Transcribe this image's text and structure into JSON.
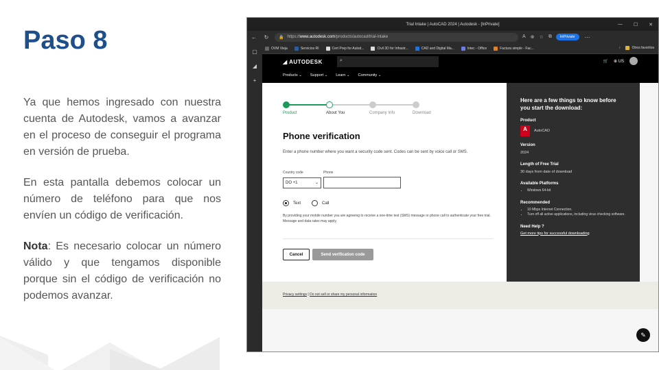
{
  "slide": {
    "title": "Paso 8",
    "p1": "Ya que hemos ingresado con nuestra cuenta de Autodesk, vamos a avanzar en el proceso de conseguir el programa en versión de prueba.",
    "p2": "En esta pantalla debemos colocar un número de teléfono para que nos envíen un código de verificación.",
    "p3_bold": "Nota",
    "p3_rest": ": Es necesario colocar un número válido y que tengamos disponible porque sin el código de verificación no podemos avanzar."
  },
  "browser": {
    "window_title": "Trial Intake | AutoCAD 2024 | Autodesk - [InPrivate]",
    "url_prefix": "https://",
    "url_host": "www.autodesk.com",
    "url_path": "/products/autocad/trial-intake",
    "inprivate_label": "InPrivate",
    "bookmarks": [
      {
        "label": "OVM Vieja",
        "color": "#666666"
      },
      {
        "label": "Servicios RI",
        "color": "#2a5ea8"
      },
      {
        "label": "Cert Prep for Autod...",
        "color": "#dddddd"
      },
      {
        "label": "Civil 3D for Infrastr...",
        "color": "#dddddd"
      },
      {
        "label": "CAD and Digital Ma...",
        "color": "#1a73e8"
      },
      {
        "label": "Intec - Office",
        "color": "#6b7de8"
      },
      {
        "label": "Factura simple - Fac...",
        "color": "#e67e22"
      }
    ],
    "other_favorites": "Otros favoritos"
  },
  "header": {
    "logo": "AUTODESK",
    "region": "US",
    "menu": [
      "Products ⌄",
      "Support ⌄",
      "Learn ⌄",
      "Community ⌄"
    ]
  },
  "stepper": {
    "steps": [
      "Product",
      "About You",
      "Company Info",
      "Download"
    ],
    "colors": {
      "done": "#1c9a5b",
      "pending": "#cccccc"
    }
  },
  "form": {
    "title": "Phone verification",
    "description": "Enter a phone number where you want a security code sent. Codes can be sent by voice call or SMS.",
    "country_label": "Country code",
    "phone_label": "Phone",
    "country_value": "DO +1",
    "phone_value": "",
    "radio_text": "Text",
    "radio_call": "Call",
    "radio_selected": "Text",
    "legal": "By providing your mobile number you are agreeing to receive a one-time text (SMS) message or phone call to authenticate your free trial. Message and data rates may apply.",
    "cancel": "Cancel",
    "send": "Send verification code"
  },
  "info": {
    "title": "Here are a few things to know before you start the download:",
    "product_h": "Product",
    "product_v": "AutoCAD",
    "product_icon_letter": "A",
    "version_h": "Version",
    "version_v": "2024",
    "length_h": "Length of Free Trial",
    "length_v": "30 days from date of download",
    "platforms_h": "Available Platforms",
    "platforms": [
      "Windows 64-bit"
    ],
    "recommended_h": "Recommended",
    "recommended": [
      "10 Mbps Internet Connection.",
      "Turn off all active applications, including virus checking software."
    ],
    "help_h": "Need Help ?",
    "help_link": "Get more tips for successful downloading"
  },
  "footer": {
    "privacy": "Privacy settings",
    "sep": " | ",
    "do_not_sell": "Do not sell or share my personal information"
  }
}
